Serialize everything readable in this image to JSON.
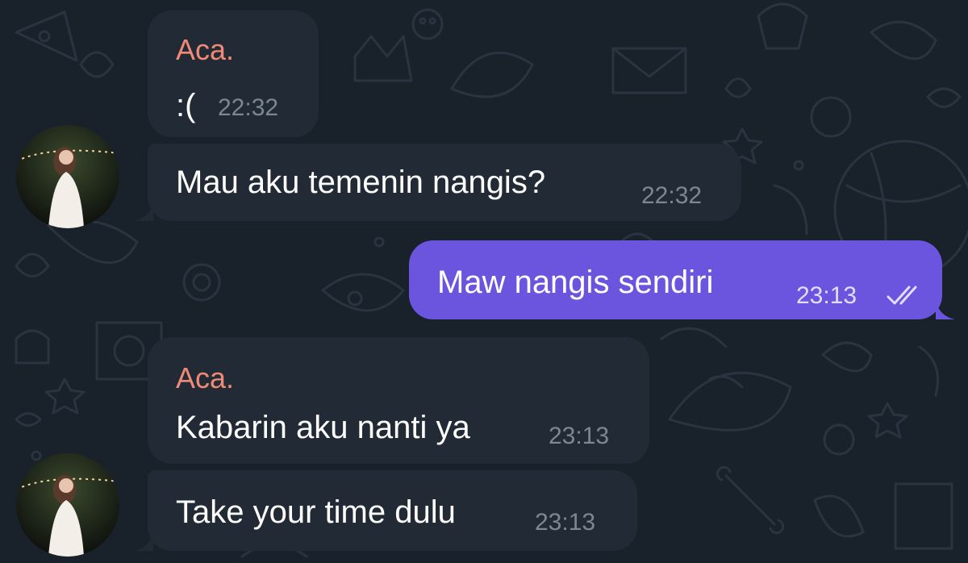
{
  "colors": {
    "background": "#19212b",
    "incoming_bubble": "#222b35",
    "outgoing_bubble": "#6b55df",
    "sender_name": "#ef8a76",
    "timestamp": "#7b8893"
  },
  "messages": [
    {
      "direction": "incoming",
      "sender": "Aca.",
      "text": ":(",
      "time": "22:32"
    },
    {
      "direction": "incoming",
      "sender": "",
      "text": "Mau aku temenin nangis?",
      "time": "22:32"
    },
    {
      "direction": "outgoing",
      "text": "Maw nangis sendiri",
      "time": "23:13",
      "status": "read-double-check-icon"
    },
    {
      "direction": "incoming",
      "sender": "Aca.",
      "text": "Kabarin aku nanti ya",
      "time": "23:13"
    },
    {
      "direction": "incoming",
      "sender": "",
      "text": "Take your time dulu",
      "time": "23:13"
    }
  ],
  "avatars": [
    {
      "icon": "contact-photo-avatar"
    },
    {
      "icon": "contact-photo-avatar"
    }
  ]
}
